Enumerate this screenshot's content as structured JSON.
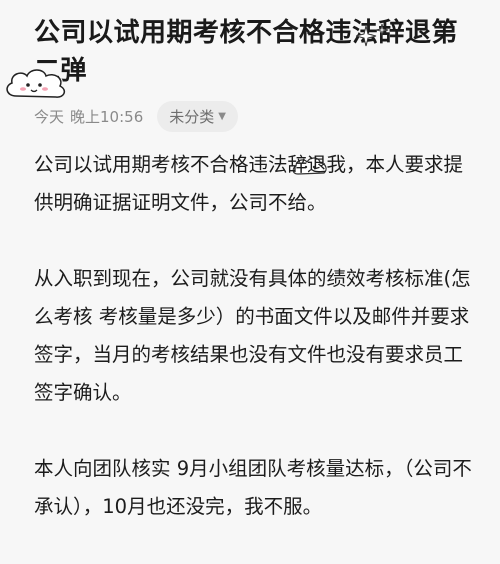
{
  "note": {
    "title": "公司以试用期考核不合格违法辞退第二弹",
    "meta": {
      "date": "今天",
      "time": "晚上10:56",
      "category": "未分类"
    },
    "paragraphs": [
      "公司以试用期考核不合格违法辞退我，本人要求提供明确证据证明文件，公司不给。",
      "从入职到现在，公司就没有具体的绩效考核标准(怎么考核 考核量是多少）的书面文件以及邮件并要求签字，当月的考核结果也没有文件也没有要求员工签字确认。",
      "本人向团队核实 9月小组团队考核量达标，（公司不承认），10月也还没完，我不服。"
    ]
  },
  "icons": {
    "category_chevron": "chevron-down-icon",
    "sticker": "cloud-sticker-icon"
  },
  "colors": {
    "background": "#f7f7f7",
    "text": "#1a1a1a",
    "meta_text": "#8a8a8a",
    "tag_bg": "#ececec"
  }
}
